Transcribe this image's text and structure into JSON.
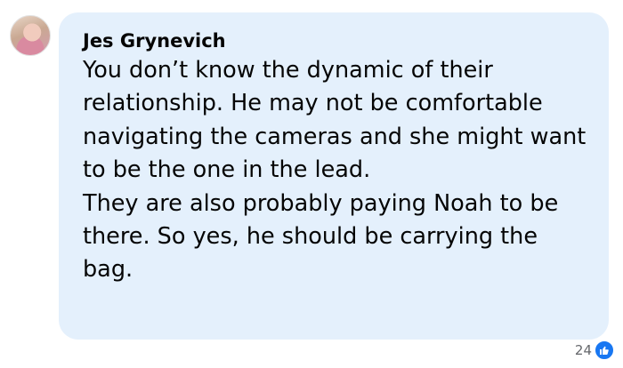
{
  "comment": {
    "author": "Jes Grynevich",
    "paragraphs": [
      "You don’t know the dynamic of their relationship. He may not be comfortable navigating the cameras and she might want to be the one in the lead.",
      "They are also probably paying Noah to be there. So yes, he should be carrying the bag."
    ],
    "reactions": {
      "count": "24",
      "icon": "like-icon",
      "color": "#1877f2"
    },
    "bubble_color": "#e4f0fc"
  }
}
